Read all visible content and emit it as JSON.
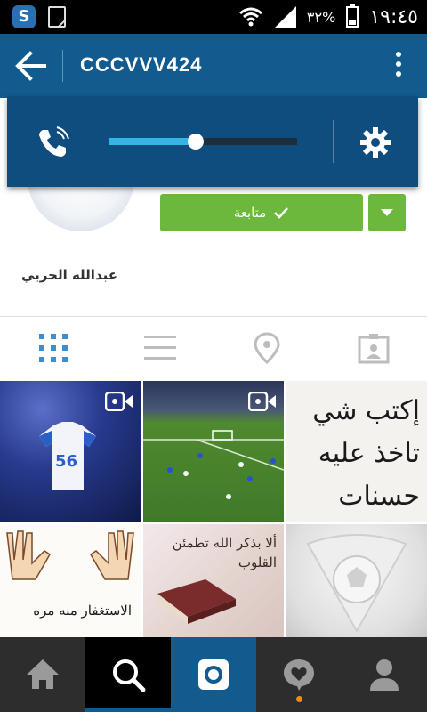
{
  "status_bar": {
    "time": "١٩:٤٥",
    "battery_percent": "٣٢%",
    "icons": [
      "app-s-icon",
      "sim-icon",
      "wifi-icon",
      "signal-icon",
      "battery-icon"
    ]
  },
  "header": {
    "username": "CCCVVV424",
    "back_icon": "arrow-left-icon",
    "menu_icon": "overflow-menu-icon",
    "bar_color": "#115b8e"
  },
  "volume_panel": {
    "stream_icon": "phone-call-icon",
    "level": 0.46,
    "settings_icon": "gear-icon",
    "slider_color": "#33b5e5"
  },
  "profile": {
    "display_name": "عبدالله الحربي",
    "follow_label": "متابعة",
    "follow_color": "#6cb83d"
  },
  "view_tabs": [
    "grid-icon",
    "list-icon",
    "map-pin-icon",
    "tagged-photos-icon"
  ],
  "photos": [
    {
      "name": "photo-jersey-56",
      "video": true
    },
    {
      "name": "photo-football-pitch",
      "video": true
    },
    {
      "name": "photo-arabic-calligraphy",
      "video": false,
      "text": "إكتب شي تاخذ عليه حسنات"
    },
    {
      "name": "photo-counting-hands",
      "video": false,
      "text": "الاستغفار منه مره"
    },
    {
      "name": "photo-quran",
      "video": false,
      "text": "ألا بذكر الله تطمئن القلوب"
    },
    {
      "name": "photo-alhilal-logo",
      "video": false
    }
  ],
  "bottom_nav": {
    "items": [
      "home-icon",
      "search-icon",
      "camera-icon",
      "news-heart-icon",
      "profile-icon"
    ],
    "active": "search-icon",
    "notification_color": "#f48a16"
  }
}
